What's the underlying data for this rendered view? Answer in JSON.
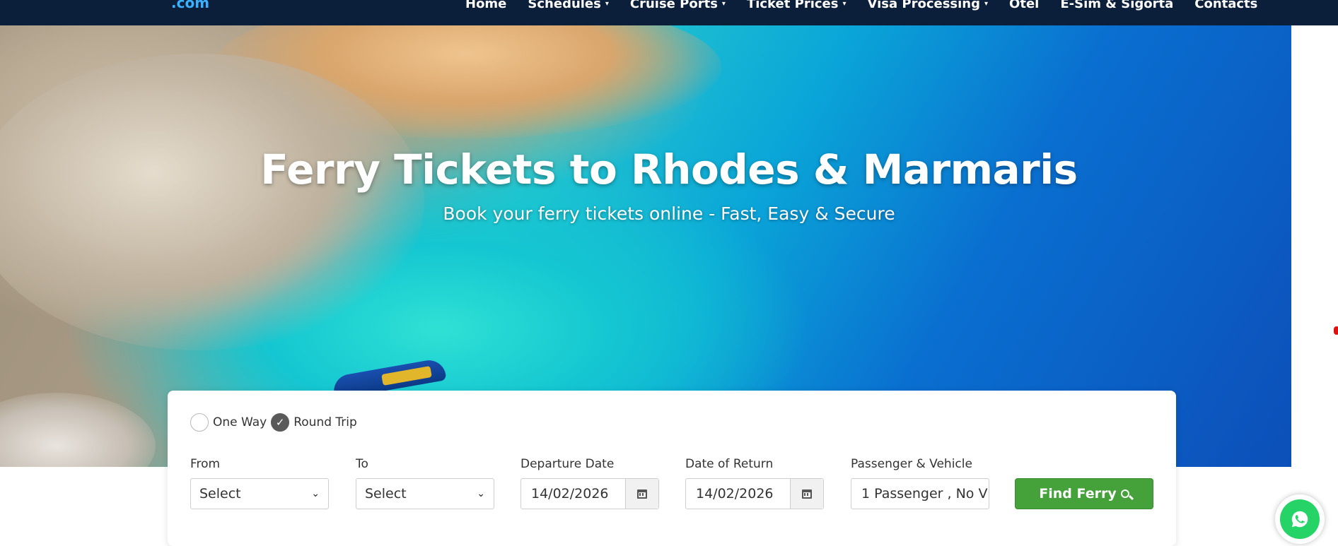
{
  "logo": {
    "text": "",
    "suffix": ".com"
  },
  "nav": {
    "items": [
      {
        "label": "Home",
        "has_dropdown": false
      },
      {
        "label": "Schedules",
        "has_dropdown": true
      },
      {
        "label": "Cruise Ports",
        "has_dropdown": true
      },
      {
        "label": "Ticket Prices",
        "has_dropdown": true
      },
      {
        "label": "Visa Processing",
        "has_dropdown": true
      },
      {
        "label": "Otel",
        "has_dropdown": false
      },
      {
        "label": "E-Sim & Sigorta",
        "has_dropdown": false
      },
      {
        "label": "Contacts",
        "has_dropdown": false
      }
    ]
  },
  "hero": {
    "title": "Ferry Tickets to Rhodes & Marmaris",
    "subtitle": "Book your ferry tickets online - Fast, Easy & Secure"
  },
  "search": {
    "trip_types": [
      {
        "label": "One Way",
        "selected": false
      },
      {
        "label": "Round Trip",
        "selected": true
      }
    ],
    "from": {
      "label": "From",
      "value": "Select"
    },
    "to": {
      "label": "To",
      "value": "Select"
    },
    "departure": {
      "label": "Departure Date",
      "value": "14/02/2026"
    },
    "return": {
      "label": "Date of Return",
      "value": "14/02/2026"
    },
    "passengers": {
      "label": "Passenger & Vehicle",
      "value": "1 Passenger  , No V"
    },
    "submit_label": "Find Ferry"
  },
  "colors": {
    "nav_bg": "#0b1f3a",
    "accent_green": "#45a13a",
    "whatsapp_green": "#25d366"
  },
  "icons": [
    "chevron-down-icon",
    "check-icon",
    "calendar-icon",
    "search-icon",
    "whatsapp-icon"
  ]
}
